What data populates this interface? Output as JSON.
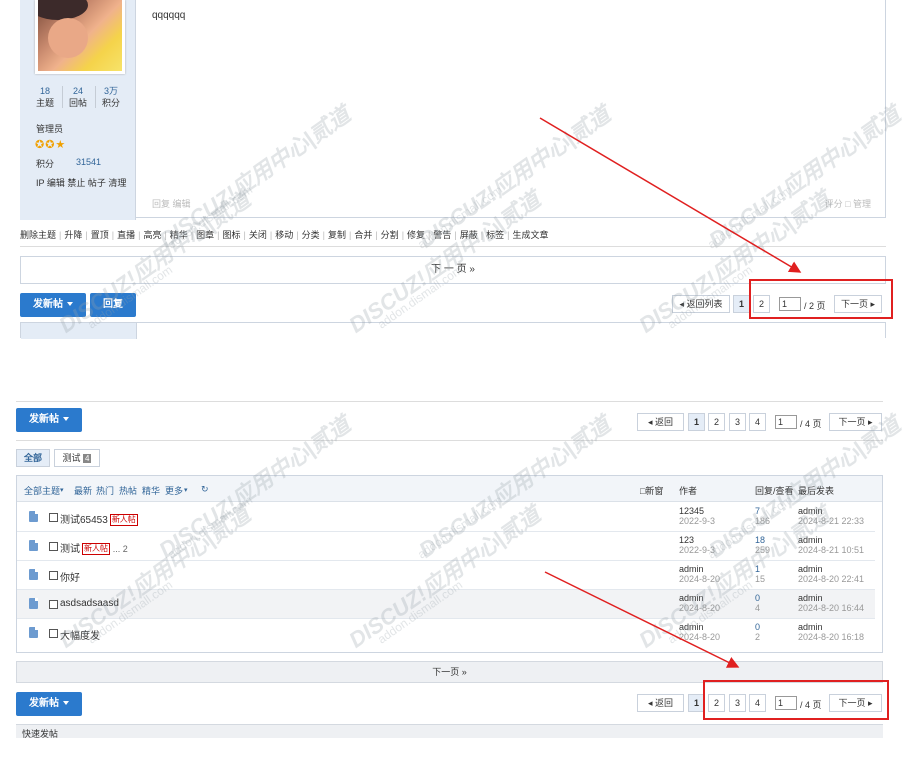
{
  "post": {
    "body_text": "qqqqqq",
    "stats": [
      {
        "value": "18",
        "label": "主题"
      },
      {
        "value": "24",
        "label": "回帖"
      },
      {
        "value": "3万",
        "label": "积分"
      }
    ],
    "role": "管理员",
    "points_label": "积分",
    "points_value": "31541",
    "admin_links": "IP 编辑 禁止 帖子 清理",
    "footer_left": "回复  编辑",
    "footer_right": "评分  □ 管理"
  },
  "modbar": [
    "删除主题",
    "升降",
    "置顶",
    "直播",
    "高亮",
    "精华",
    "图章",
    "图标",
    "关闭",
    "移动",
    "分类",
    "复制",
    "合并",
    "分割",
    "修复",
    "警告",
    "屏蔽",
    "标签",
    "生成文章"
  ],
  "top_section": {
    "next_page": "下 一 页  »",
    "new_post": "发新帖",
    "reply": "回复",
    "pager": {
      "back": "◂ 返回列表",
      "pages": [
        "1",
        "2"
      ],
      "input_value": "1",
      "total": "/ 2 页",
      "next": "下一页 ▸"
    }
  },
  "list_section": {
    "new_post": "发新帖",
    "pager": {
      "back": "◂ 返回",
      "pages": [
        "1",
        "2",
        "3",
        "4"
      ],
      "input_value": "1",
      "total": "/ 4 页",
      "next": "下一页 ▸"
    },
    "tabs": [
      {
        "label": "全部"
      },
      {
        "label": "测试",
        "count": "4"
      }
    ],
    "filters": {
      "all": "全部主题",
      "latest": "最新",
      "hot": "热门",
      "hot_posts": "热帖",
      "digest": "精华",
      "more": "更多",
      "refresh": "↻",
      "new_window": "□新窗",
      "author_col": "作者",
      "reply_col": "回复/查看",
      "last_col": "最后发表"
    },
    "threads": [
      {
        "title": "测试65453",
        "new_tag": "新人帖",
        "pages": "",
        "author": "12345",
        "date": "2022-9-3",
        "replies": "7",
        "views": "186",
        "last_user": "admin",
        "last_time": "2024-8-21 22:33"
      },
      {
        "title": "测试",
        "new_tag": "新人帖",
        "pages": "... 2",
        "author": "123",
        "date": "2022-9-3",
        "replies": "18",
        "views": "259",
        "last_user": "admin",
        "last_time": "2024-8-21 10:51"
      },
      {
        "title": "你好",
        "new_tag": "",
        "pages": "",
        "author": "admin",
        "date": "2024-8-20",
        "replies": "1",
        "views": "15",
        "last_user": "admin",
        "last_time": "2024-8-20 22:41"
      },
      {
        "title": "asdsadsaasd",
        "new_tag": "",
        "pages": "",
        "author": "admin",
        "date": "2024-8-20",
        "replies": "0",
        "views": "4",
        "last_user": "admin",
        "last_time": "2024-8-20 16:44"
      },
      {
        "title": "大幅度发",
        "new_tag": "",
        "pages": "",
        "author": "admin",
        "date": "2024-8-20",
        "replies": "0",
        "views": "2",
        "last_user": "admin",
        "last_time": "2024-8-20 16:18"
      }
    ],
    "next_page": "下一页 »",
    "quick_post": "快速发帖"
  },
  "watermark": {
    "text": "DISCUZ!应用中心|贰道",
    "url": "addon.dismall.com"
  },
  "colors": {
    "accent": "#2b7acd",
    "highlight": "#e02020",
    "side": "#e4ecf6"
  }
}
